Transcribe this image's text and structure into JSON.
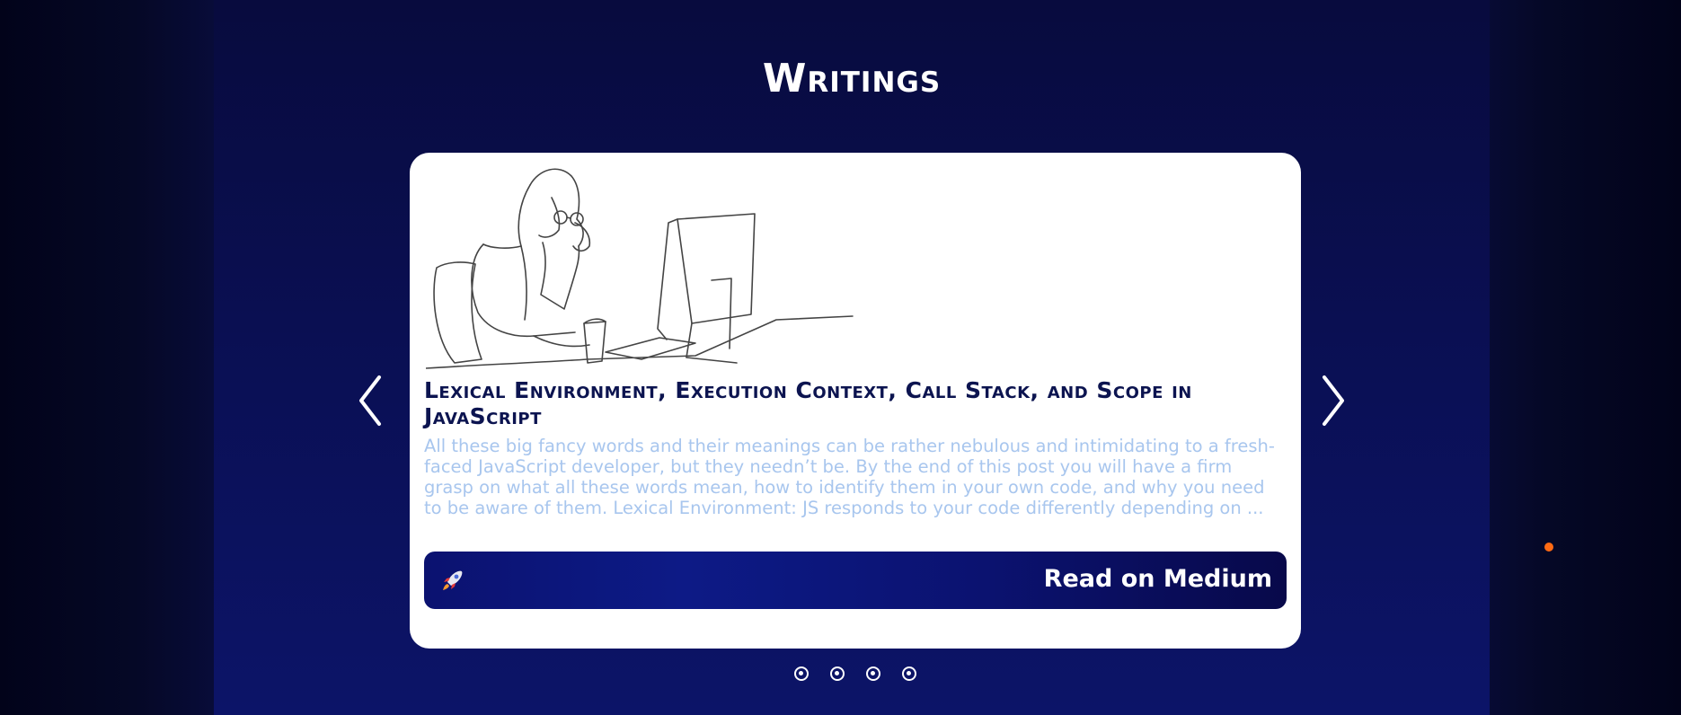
{
  "section": {
    "title": "Writings"
  },
  "carousel": {
    "post": {
      "title": "Lexical Environment, Execution Context, Call Stack, and Scope in JavaScript",
      "excerpt": "All these big fancy words and their meanings can be rather nebulous and intimidating to a fresh-faced JavaScript developer, but they needn’t be. By the end of this post you will have a firm grasp on what all these words mean, how to identify them in your own code, and why you need to be aware of them. Lexical Environment: JS responds to your code differently depending on ...",
      "button_label": "Read on Medium",
      "button_icon": "rocket-icon",
      "image": "line-drawing-woman-at-computer"
    },
    "prev_icon": "chevron-left-icon",
    "next_icon": "chevron-right-icon",
    "pagination_count": 4
  },
  "colors": {
    "background": "#080c3a",
    "panel": "#0a0f52",
    "card": "#ffffff",
    "title_text": "#0c1450",
    "excerpt_text": "#a8c6ee",
    "button": "#0d1a86",
    "accent_dot": "#ff6a13"
  }
}
